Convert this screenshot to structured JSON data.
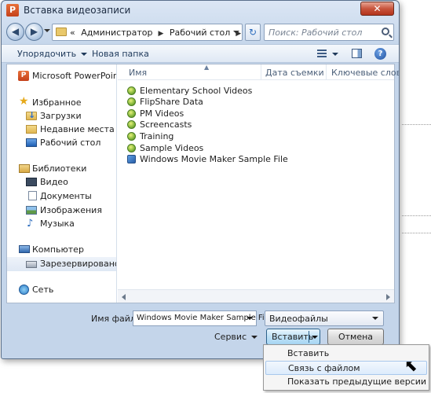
{
  "window": {
    "title": "Вставка видеозаписи",
    "close_glyph": "✕"
  },
  "nav": {
    "back_glyph": "◀",
    "forward_glyph": "▶",
    "breadcrumb": [
      "«",
      "Администратор",
      "Рабочий стол"
    ],
    "refresh_glyph": "↻",
    "search_placeholder": "Поиск: Рабочий стол"
  },
  "toolbar": {
    "organize": "Упорядочить",
    "new_folder": "Новая папка",
    "help_glyph": "?"
  },
  "sidebar": {
    "items": [
      {
        "label": "Microsoft PowerPoint",
        "icon": "powerpoint-icon"
      },
      {
        "label": "Избранное",
        "icon": "star-icon"
      },
      {
        "label": "Загрузки",
        "icon": "downloads-folder-icon"
      },
      {
        "label": "Недавние места",
        "icon": "recent-places-icon"
      },
      {
        "label": "Рабочий стол",
        "icon": "desktop-icon"
      },
      {
        "label": "Библиотеки",
        "icon": "libraries-icon"
      },
      {
        "label": "Видео",
        "icon": "video-library-icon"
      },
      {
        "label": "Документы",
        "icon": "documents-icon"
      },
      {
        "label": "Изображения",
        "icon": "pictures-icon"
      },
      {
        "label": "Музыка",
        "icon": "music-icon"
      },
      {
        "label": "Компьютер",
        "icon": "computer-icon"
      },
      {
        "label": "Зарезервировано сис",
        "icon": "drive-icon"
      },
      {
        "label": "Сеть",
        "icon": "network-icon"
      }
    ]
  },
  "columns": {
    "name": "Имя",
    "date": "Дата съемки",
    "keywords": "Ключевые слова"
  },
  "files": [
    {
      "name": "Elementary School Videos",
      "icon": "library-folder-icon"
    },
    {
      "name": "FlipShare Data",
      "icon": "library-folder-icon"
    },
    {
      "name": "PM Videos",
      "icon": "library-folder-icon"
    },
    {
      "name": "Screencasts",
      "icon": "library-folder-icon"
    },
    {
      "name": "Training",
      "icon": "library-folder-icon"
    },
    {
      "name": "Sample Videos",
      "icon": "library-folder-icon"
    },
    {
      "name": "Windows Movie Maker Sample File",
      "icon": "movie-file-icon"
    }
  ],
  "form": {
    "filename_label": "Имя файла:",
    "filename_value": "Windows Movie Maker Sample File",
    "filetype_value": "Видеофайлы",
    "tools_label": "Сервис",
    "insert_label": "Вставить",
    "cancel_label": "Отмена"
  },
  "insert_menu": {
    "items": [
      "Вставить",
      "Связь с файлом",
      "Показать предыдущие версии"
    ],
    "hovered_index": 1
  },
  "colors": {
    "window_frame": "#c4d5ea",
    "accent": "#2c628b",
    "close_button": "#c8553d"
  }
}
